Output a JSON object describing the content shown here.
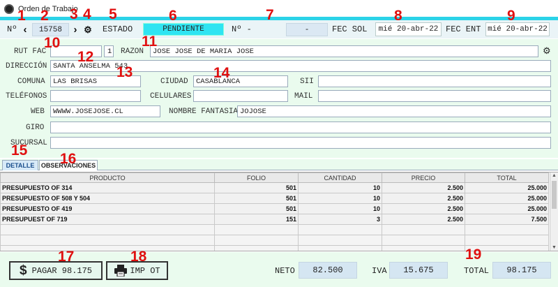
{
  "window": {
    "title": "Orden de Trabajo"
  },
  "header": {
    "numero_label": "Nº",
    "numero_value": "15758",
    "estado_label": "ESTADO",
    "estado_value": "PENDIENTE",
    "estado_color": "#2fe4f2",
    "numero2_label": "Nº -",
    "numero2_value": "-",
    "fec_sol_label": "FEC  SOL",
    "fec_sol_value": "mié 20-abr-22",
    "fec_ent_label": "FEC ENT",
    "fec_ent_value": "mié 20-abr-22"
  },
  "form": {
    "rut_label": "RUT FAC",
    "rut_value": "",
    "rut_dv_value": "1",
    "razon_label": "RAZON",
    "razon_value": "JOSE JOSE DE MARIA JOSE",
    "direccion_label": "DIRECCIÓN",
    "direccion_value": "SANTA ANSELMA 543",
    "comuna_label": "COMUNA",
    "comuna_value": "LAS BRISAS",
    "ciudad_label": "CIUDAD",
    "ciudad_value": "CASABLANCA",
    "sii_label": "SII",
    "sii_value": "",
    "telefonos_label": "TELÉFONOS",
    "telefonos_value": "",
    "celulares_label": "CELULARES",
    "celulares_value": "",
    "mail_label": "MAIL",
    "mail_value": "",
    "web_label": "WEB",
    "web_value": "WWWW.JOSEJOSE.CL",
    "fantasia_label": "NOMBRE FANTASIA",
    "fantasia_value": "JOJOSE",
    "giro_label": "GIRO",
    "giro_value": "",
    "sucursal_label": "SUCURSAL",
    "sucursal_value": ""
  },
  "tabs": [
    {
      "label": "DETALLE"
    },
    {
      "label": "OBSERVACIONES"
    }
  ],
  "table": {
    "columns": [
      "PRODUCTO",
      "FOLIO",
      "CANTIDAD",
      "PRECIO",
      "TOTAL"
    ],
    "rows": [
      [
        "PRESUPUESTO OF 314",
        "501",
        "10",
        "2.500",
        "25.000"
      ],
      [
        "PRESUPUESTO OF 508 Y 504",
        "501",
        "10",
        "2.500",
        "25.000"
      ],
      [
        "PRESUPUESTO OF 419",
        "501",
        "10",
        "2.500",
        "25.000"
      ],
      [
        "PRESUPUEST OF 719",
        "151",
        "3",
        "2.500",
        "7.500"
      ]
    ]
  },
  "footer": {
    "pagar_label": "PAGAR 98.175",
    "imp_label": "IMP OT",
    "neto_label": "NETO",
    "neto_value": "82.500",
    "iva_label": "IVA",
    "iva_value": "15.675",
    "total_label": "TOTAL",
    "total_value": "98.175"
  },
  "markers": {
    "m1": "1",
    "m2": "2",
    "m3": "3",
    "m4": "4",
    "m5": "5",
    "m6": "6",
    "m7": "7",
    "m8": "8",
    "m9": "9",
    "m10": "10",
    "m11": "11",
    "m12": "12",
    "m13": "13",
    "m14": "14",
    "m15": "15",
    "m16": "16",
    "m17": "17",
    "m18": "18",
    "m19": "19"
  }
}
